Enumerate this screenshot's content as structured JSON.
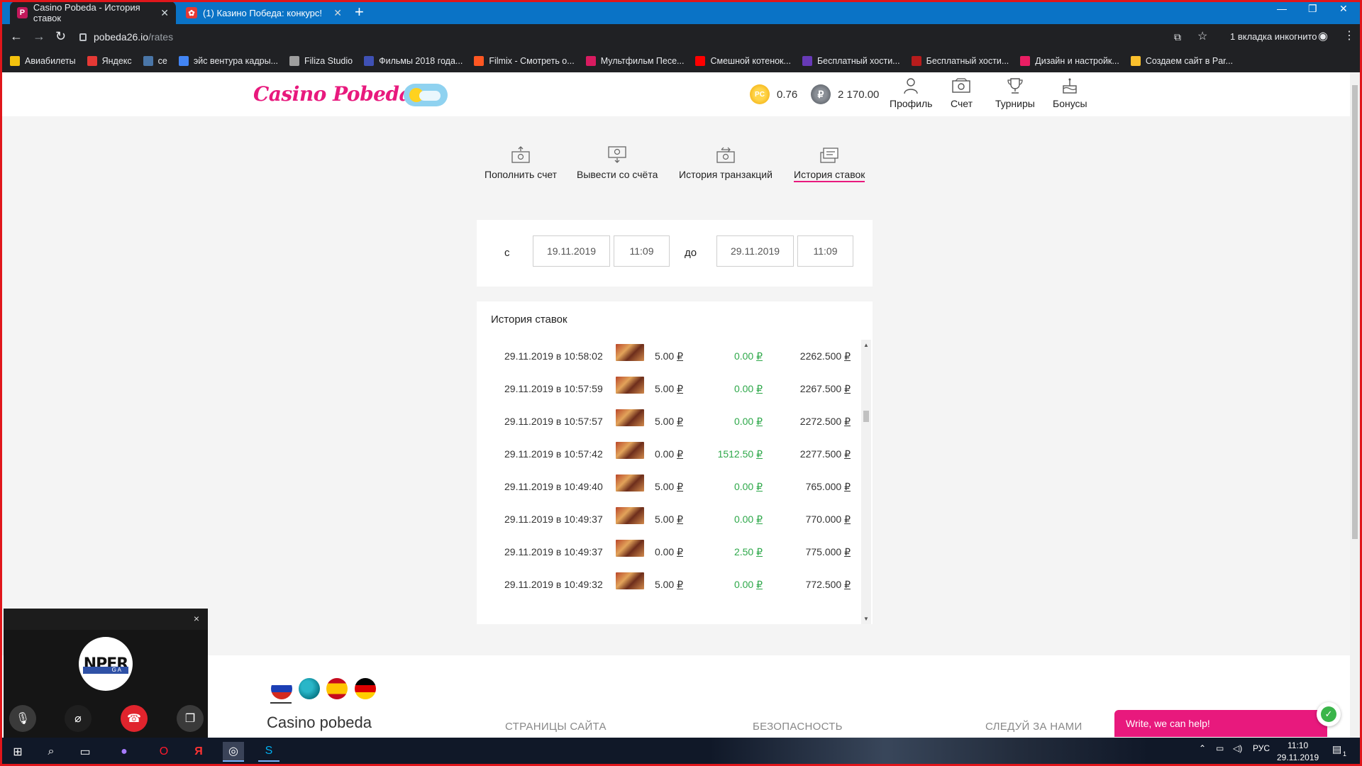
{
  "browser": {
    "tabs": [
      {
        "title": "Casino Pobeda - История ставок",
        "favicon_letter": "P",
        "favicon_color": "#c2185b",
        "active": true
      },
      {
        "title": "(1) Казино Победа: конкурс!",
        "favicon_letter": "✿",
        "favicon_color": "#e53935",
        "active": false
      }
    ],
    "url_host": "pobeda26.io",
    "url_path": "/rates",
    "incognito_label": "1 вкладка инкогнито",
    "bookmarks": [
      {
        "label": "Авиабилеты",
        "color": "#f4c20d"
      },
      {
        "label": "Яндекс",
        "color": "#e53935"
      },
      {
        "label": "се",
        "color": "#4a76a8"
      },
      {
        "label": "эйс вентура кадры...",
        "color": "#4285f4"
      },
      {
        "label": "Filiza Studio",
        "color": "#9e9e9e"
      },
      {
        "label": "Фильмы 2018 года...",
        "color": "#3f51b5"
      },
      {
        "label": "Filmix - Смотреть о...",
        "color": "#ff5722"
      },
      {
        "label": "Мультфильм Песе...",
        "color": "#d81b60"
      },
      {
        "label": "Смешной котенок...",
        "color": "#ff0000"
      },
      {
        "label": "Бесплатный хости...",
        "color": "#673ab7"
      },
      {
        "label": "Бесплатный хости...",
        "color": "#b71c1c"
      },
      {
        "label": "Дизайн и настройк...",
        "color": "#e91e63"
      },
      {
        "label": "Создаем сайт в Par...",
        "color": "#fbc02d"
      }
    ]
  },
  "header": {
    "logo": "Casino Pobeda",
    "balance_pc_label": "PC",
    "balance_pc": "0.76",
    "balance_rub_label": "₽",
    "balance_rub": "2 170.00",
    "nav": [
      "Профиль",
      "Счет",
      "Турниры",
      "Бонусы"
    ]
  },
  "account_tabs": [
    "Пополнить счет",
    "Вывести со счёта",
    "История транзакций",
    "История ставок"
  ],
  "filter": {
    "from_label": "с",
    "to_label": "до",
    "from_date": "19.11.2019",
    "from_time": "11:09",
    "to_date": "29.11.2019",
    "to_time": "11:09"
  },
  "history": {
    "title": "История ставок",
    "currency": "₽",
    "rows": [
      {
        "datetime": "29.11.2019 в 10:58:02",
        "bet": "5.00",
        "win": "0.00",
        "balance": "2262.500"
      },
      {
        "datetime": "29.11.2019 в 10:57:59",
        "bet": "5.00",
        "win": "0.00",
        "balance": "2267.500"
      },
      {
        "datetime": "29.11.2019 в 10:57:57",
        "bet": "5.00",
        "win": "0.00",
        "balance": "2272.500"
      },
      {
        "datetime": "29.11.2019 в 10:57:42",
        "bet": "0.00",
        "win": "1512.50",
        "balance": "2277.500"
      },
      {
        "datetime": "29.11.2019 в 10:49:40",
        "bet": "5.00",
        "win": "0.00",
        "balance": "765.000"
      },
      {
        "datetime": "29.11.2019 в 10:49:37",
        "bet": "5.00",
        "win": "0.00",
        "balance": "770.000"
      },
      {
        "datetime": "29.11.2019 в 10:49:37",
        "bet": "0.00",
        "win": "2.50",
        "balance": "775.000"
      },
      {
        "datetime": "29.11.2019 в 10:49:32",
        "bet": "5.00",
        "win": "0.00",
        "balance": "772.500"
      }
    ]
  },
  "footer": {
    "brand": "Casino pobeda",
    "columns": [
      "СТРАНИЦЫ САЙТА",
      "БЕЗОПАСНОСТЬ",
      "СЛЕДУЙ ЗА НАМИ"
    ],
    "languages": [
      "russian-flag",
      "globe",
      "spanish-flag",
      "german-flag"
    ]
  },
  "chat": {
    "label": "Write, we can help!",
    "check": "✓"
  },
  "call": {
    "avatar_text": "NPER",
    "avatar_sub": "G A",
    "close": "×"
  },
  "taskbar": {
    "lang": "РУС",
    "time": "11:10",
    "date": "29.11.2019",
    "notification_count": "1"
  },
  "colors": {
    "accent": "#e8197d",
    "win_green": "#2ea84a",
    "tabstrip": "#0a73c6"
  }
}
